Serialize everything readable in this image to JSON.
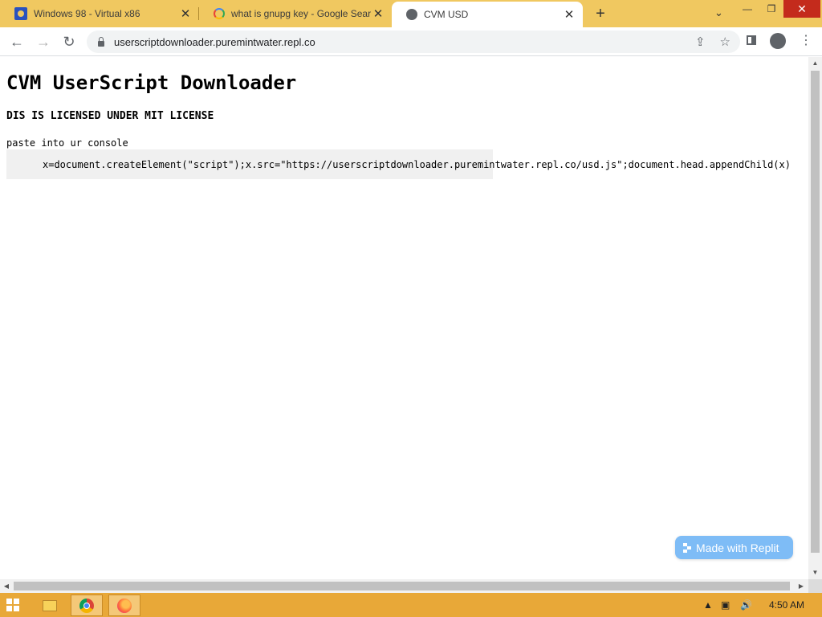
{
  "browser": {
    "tabs": [
      {
        "title": "Windows 98 - Virtual x86",
        "icon": "windows98-favicon",
        "active": false
      },
      {
        "title": "what is gnupg key - Google Search",
        "icon": "google-favicon",
        "active": false
      },
      {
        "title": "CVM USD",
        "icon": "globe-icon",
        "active": true
      }
    ],
    "url": "userscriptdownloader.puremintwater.repl.co"
  },
  "page": {
    "heading": "CVM UserScript Downloader",
    "license": "DIS IS LICENSED UNDER MIT LICENSE",
    "instruction": "paste into ur console",
    "code": "x=document.createElement(\"script\");x.src=\"https://userscriptdownloader.puremintwater.repl.co/usd.js\";document.head.appendChild(x)",
    "badge": "Made with Replit"
  },
  "taskbar": {
    "clock": "4:50 AM"
  },
  "colors": {
    "tabstrip": "#f0c860",
    "taskbar": "#e8a838",
    "badge": "#7ebcf6"
  }
}
